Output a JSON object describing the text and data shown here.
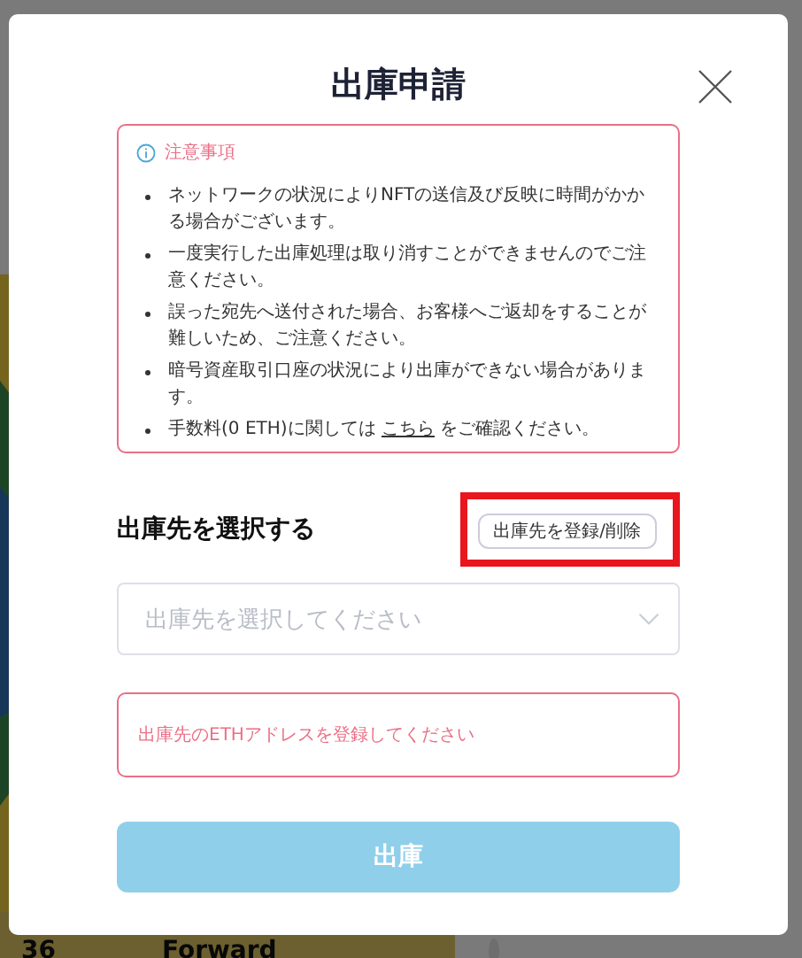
{
  "background": {
    "card_number": "36",
    "card_position": "Forward"
  },
  "modal": {
    "title": "出庫申請",
    "notice": {
      "title": "注意事項",
      "items": [
        {
          "kind": "text",
          "text": "ネットワークの状況によりNFTの送信及び反映に時間がかかる場合がございます。"
        },
        {
          "kind": "text",
          "text": "一度実行した出庫処理は取り消すことができませんのでご注意ください。"
        },
        {
          "kind": "text",
          "text": "誤った宛先へ送付された場合、お客様へご返却をすることが難しいため、ご注意ください。"
        },
        {
          "kind": "text",
          "text": "暗号資産取引口座の状況により出庫ができない場合があります。"
        },
        {
          "kind": "link",
          "before": "手数料(0 ETH)に関しては",
          "link": "こちら",
          "after": "をご確認ください。"
        }
      ]
    },
    "destination_heading": "出庫先を選択する",
    "register_button": "出庫先を登録/削除",
    "register_highlighted": true,
    "destination_select": {
      "placeholder": "出庫先を選択してください"
    },
    "error_message": "出庫先のETHアドレスを登録してください",
    "submit_button": {
      "label": "出庫",
      "disabled": true
    }
  }
}
